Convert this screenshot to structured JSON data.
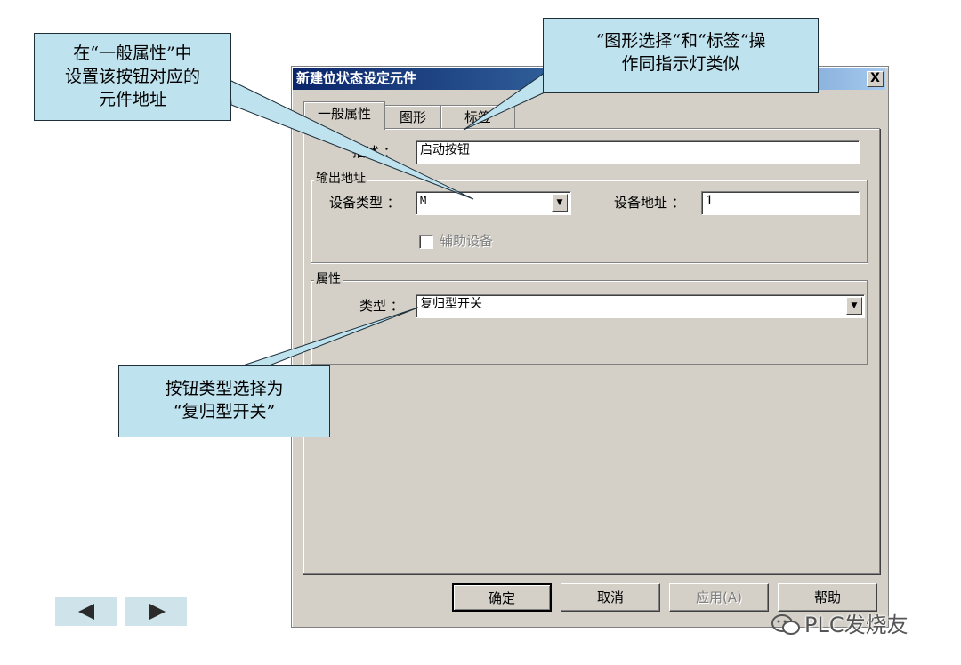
{
  "dialog": {
    "title": "新建位状态设定元件",
    "close_label": "X",
    "tabs": [
      {
        "label": "一般属性"
      },
      {
        "label": "图形"
      },
      {
        "label": "标签"
      }
    ],
    "description": {
      "label": "描述 ：",
      "value": "启动按钮"
    },
    "output_group": {
      "legend": "输出地址",
      "device_type": {
        "label": "设备类型 ：",
        "value": "M"
      },
      "device_address": {
        "label": "设备地址 ：",
        "value": "1"
      },
      "aux_device": {
        "label": "辅助设备",
        "checked": false
      }
    },
    "attr_group": {
      "legend": "属性",
      "type": {
        "label": "类型 ：",
        "value": "复归型开关"
      }
    },
    "buttons": {
      "ok": "确定",
      "cancel": "取消",
      "apply": "应用(A)",
      "help": "帮助"
    }
  },
  "callouts": {
    "general": [
      "在“一般属性”中",
      "设置该按钮对应的",
      "元件地址"
    ],
    "graphics": [
      "“图形选择“和“标签“操",
      "作同指示灯类似"
    ],
    "button_type": [
      "按钮类型选择为",
      "“复归型开关”"
    ]
  },
  "watermark": "PLC发烧友",
  "icons": {
    "prev": "left-triangle",
    "next": "right-triangle",
    "dropdown": "down-triangle",
    "watermark_logo": "wechat-icon"
  },
  "colors": {
    "callout_fill": "#bfe2ef",
    "titlebar_start": "#0a246a",
    "titlebar_end": "#a6caf0",
    "dialog_face": "#d4d0c8",
    "nav_button": "#cfe3ea"
  }
}
